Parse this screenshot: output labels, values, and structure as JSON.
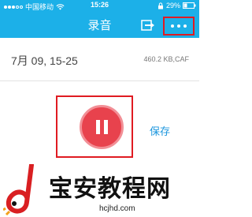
{
  "status_bar": {
    "carrier": "中国移动",
    "time": "15:26",
    "battery": "29%",
    "signal_bars_filled": 3,
    "signal_bars_total": 5
  },
  "nav": {
    "title": "录音",
    "export_icon": "export-icon",
    "more_icon": "more-icon"
  },
  "recording": {
    "name": "7月 09, 15-25",
    "info": "460.2 KB,CAF"
  },
  "player": {
    "pause_icon": "pause-icon",
    "save_label": "保存"
  },
  "watermark": {
    "title": "宝安教程网",
    "url": "hcjhd.com"
  },
  "colors": {
    "header": "#1cb0e8",
    "highlight_box": "#e01b22",
    "pause_button": "#e8424d",
    "save_link": "#1a95dd"
  }
}
